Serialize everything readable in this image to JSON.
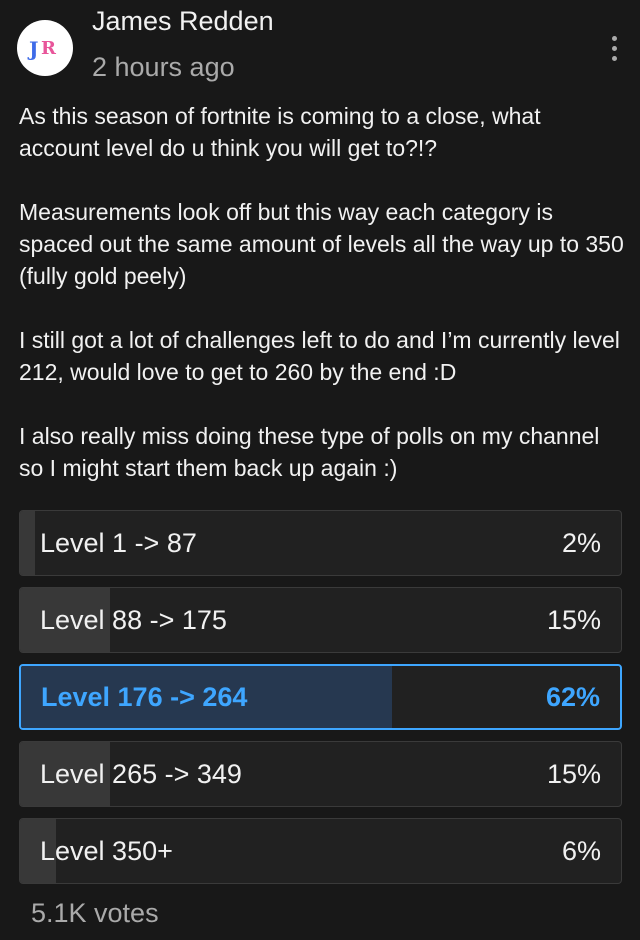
{
  "post": {
    "author": "James Redden",
    "time": "2 hours ago",
    "avatar_initials": "JR",
    "avatar_colors": {
      "j": "#3e6be8",
      "r": "#e8559a",
      "bg": "#ffffff"
    },
    "paragraphs": [
      "As this season of fortnite is coming to a close, what account level do u think you will get to?!?",
      "Measurements look off but this way each category is spaced out the same amount of levels all the way up to 350 (fully gold peely)",
      "I still got a lot of challenges left to do and I’m currently level 212, would love to get to 260 by the end :D",
      "I also really miss doing these type of polls on my channel so I might start them back up again :)"
    ],
    "more_icon": "vertical-ellipsis-icon"
  },
  "poll": {
    "options": [
      {
        "label": "Level 1 -> 87",
        "percent_text": "2%",
        "percent": 2,
        "selected": false
      },
      {
        "label": "Level 88 -> 175",
        "percent_text": "15%",
        "percent": 15,
        "selected": false
      },
      {
        "label": "Level 176 -> 264",
        "percent_text": "62%",
        "percent": 62,
        "selected": true
      },
      {
        "label": "Level 265 -> 349",
        "percent_text": "15%",
        "percent": 15,
        "selected": false
      },
      {
        "label": "Level 350+",
        "percent_text": "6%",
        "percent": 6,
        "selected": false
      }
    ],
    "votes": "5.1K votes",
    "accent_color": "#3ea6ff"
  }
}
